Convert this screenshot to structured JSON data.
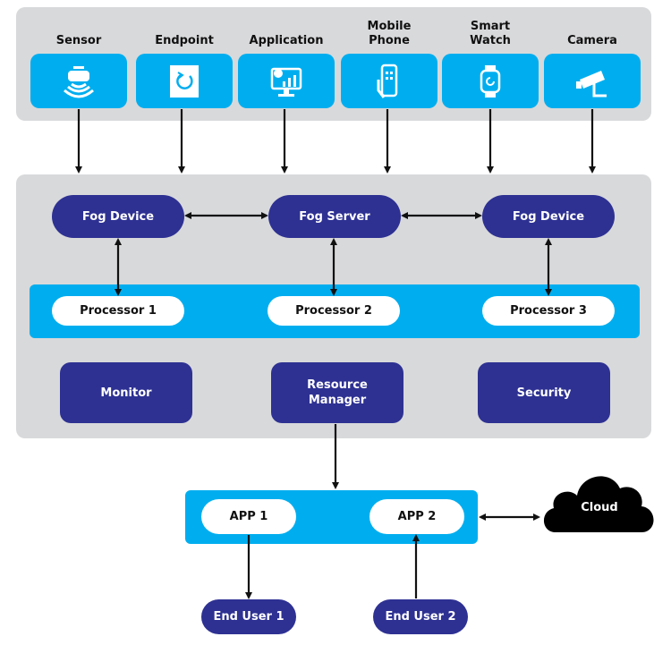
{
  "devices": [
    {
      "label": "Sensor",
      "icon": "sensor-icon"
    },
    {
      "label": "Endpoint",
      "icon": "endpoint-icon"
    },
    {
      "label": "Application",
      "icon": "application-monitor-icon"
    },
    {
      "label": "Mobile\nPhone",
      "icon": "mobile-phone-icon"
    },
    {
      "label": "Smart\nWatch",
      "icon": "smart-watch-icon"
    },
    {
      "label": "Camera",
      "icon": "camera-icon"
    }
  ],
  "fog": {
    "left": "Fog Device",
    "center": "Fog Server",
    "right": "Fog Device"
  },
  "processors": [
    "Processor 1",
    "Processor 2",
    "Processor 3"
  ],
  "services": {
    "monitor": "Monitor",
    "resource_manager": "Resource\nManager",
    "security": "Security"
  },
  "apps": [
    "APP 1",
    "APP 2"
  ],
  "cloud": "Cloud",
  "end_users": [
    "End User 1",
    "End User 2"
  ],
  "colors": {
    "blue": "#00aeef",
    "navy": "#2e3192",
    "panel": "#d8d9db"
  }
}
